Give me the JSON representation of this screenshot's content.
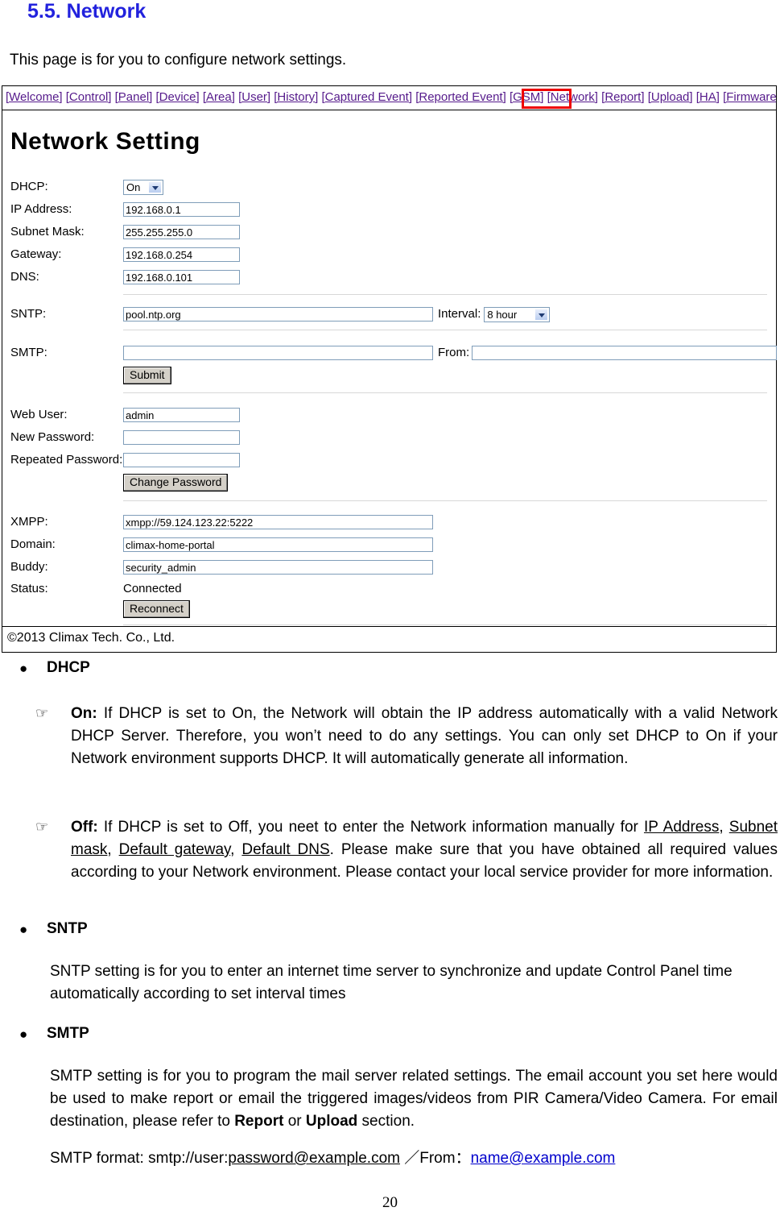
{
  "document": {
    "heading": "5.5. Network",
    "intro": "This page is for you to configure network settings.",
    "page_number": "20"
  },
  "screen": {
    "nav": {
      "items": [
        {
          "label": "[Welcome]",
          "highlighted": false
        },
        {
          "label": "[Control]",
          "highlighted": false
        },
        {
          "label": "[Panel]",
          "highlighted": false
        },
        {
          "label": "[Device]",
          "highlighted": false
        },
        {
          "label": "[Area]",
          "highlighted": false
        },
        {
          "label": "[User]",
          "highlighted": false
        },
        {
          "label": "[History]",
          "highlighted": false
        },
        {
          "label": "[Captured Event]",
          "highlighted": false
        },
        {
          "label": "[Reported Event]",
          "highlighted": false
        },
        {
          "label": "[GSM]",
          "highlighted": false
        },
        {
          "label": "[Network]",
          "highlighted": true
        },
        {
          "label": "[Report]",
          "highlighted": false
        },
        {
          "label": "[Upload]",
          "highlighted": false
        },
        {
          "label": "[HA]",
          "highlighted": false
        },
        {
          "label": "[Firmware]",
          "highlighted": false
        }
      ],
      "highlight_color": "#ee0000"
    },
    "title": "Network Setting",
    "fields": {
      "dhcp_label": "DHCP:",
      "dhcp_value": "On",
      "ip_label": "IP Address:",
      "ip_value": "192.168.0.1",
      "subnet_label": "Subnet Mask:",
      "subnet_value": "255.255.255.0",
      "gateway_label": "Gateway:",
      "gateway_value": "192.168.0.254",
      "dns_label": "DNS:",
      "dns_value": "192.168.0.101",
      "sntp_label": "SNTP:",
      "sntp_value": "pool.ntp.org",
      "interval_label": "Interval:",
      "interval_value": "8 hour",
      "smtp_label": "SMTP:",
      "smtp_value": "",
      "from_label": "From:",
      "from_value": "",
      "submit_label": "Submit",
      "webuser_label": "Web User:",
      "webuser_value": "admin",
      "newpass_label": "New Password:",
      "newpass_value": "",
      "repeatpass_label": "Repeated Password:",
      "repeatpass_value": "",
      "change_password_label": "Change Password",
      "xmpp_label": "XMPP:",
      "xmpp_value": "xmpp://59.124.123.22:5222",
      "domain_label": "Domain:",
      "domain_value": "climax-home-portal",
      "buddy_label": "Buddy:",
      "buddy_value": "security_admin",
      "status_label": "Status:",
      "status_value": "Connected",
      "reconnect_label": "Reconnect"
    },
    "footer": "©2013 Climax Tech. Co., Ltd."
  },
  "sections": {
    "dhcp": {
      "heading": "DHCP",
      "on": {
        "term": "On:",
        "text": " If DHCP is set to On, the Network will obtain the IP address automatically with a valid Network DHCP Server. Therefore, you won’t need to do any settings. You can only set DHCP to On if your Network environment supports DHCP. It will automatically generate all information."
      },
      "off": {
        "term": "Off:",
        "text_1": " If DHCP is set to Off, you neet to enter the Network information manually for ",
        "link_1": "IP Address",
        "sep_1": ", ",
        "link_2": "Subnet mask",
        "sep_2": ", ",
        "link_3": "Default gateway",
        "sep_3": ", ",
        "link_4": "Default DNS",
        "text_2": ". Please make sure that you have obtained all required values according to your Network environment. Please contact your local service provider for more information."
      }
    },
    "sntp": {
      "heading": "SNTP",
      "text": "SNTP setting is for you to enter an internet time server to synchronize and update Control Panel time automatically according to set interval times"
    },
    "smtp": {
      "heading": "SMTP",
      "text_1": "SMTP setting is for you to program the mail server related settings. The email account you set here would be used to make report or email the triggered images/videos from PIR Camera/Video Camera. For email destination, please refer to ",
      "bold_1": "Report",
      "text_2": " or ",
      "bold_2": "Upload",
      "text_3": " section.",
      "format_prefix": "SMTP format: smtp://user:",
      "format_underlined": "password@example.com",
      "format_middle": " ／From：",
      "format_link": "name@example.com"
    }
  }
}
